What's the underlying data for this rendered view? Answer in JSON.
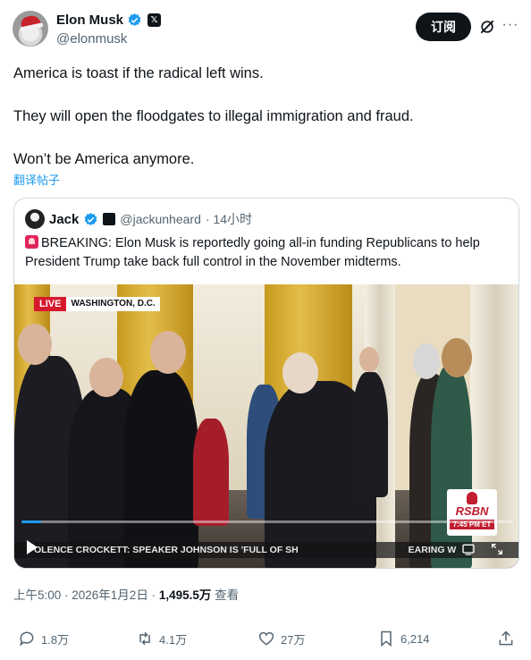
{
  "author": {
    "name": "Elon Musk",
    "handle": "@elonmusk",
    "subscribe_label": "订阅",
    "verified_color": "#1d9bf0"
  },
  "tweet": {
    "lines": [
      "America is toast if the radical left wins.",
      "They will open the floodgates to illegal immigration and fraud.",
      "Won’t be America anymore."
    ],
    "translate_label": "翻译帖子"
  },
  "quote": {
    "name": "Jack",
    "handle": "@jackunheard",
    "time": "· 14小时",
    "text": "BREAKING: Elon Musk is reportedly going all-in funding Republicans to help President Trump take back full control in the November midterms.",
    "video": {
      "live_label": "LIVE",
      "location": "WASHINGTON, D.C.",
      "brand": "RSBN",
      "brand_time": "7:45 PM ET",
      "ticker": "OLENCE    CROCKETT: SPEAKER JOHNSON IS 'FULL OF SH",
      "ticker_tail": "EARING W",
      "progress": 0.04
    }
  },
  "meta": {
    "timestamp": "上午5:00 · 2026年1月2日 · ",
    "views": "1,495.5万",
    "views_label": " 查看"
  },
  "actions": {
    "replies": "1.8万",
    "reposts": "4.1万",
    "likes": "27万",
    "bookmarks": "6,214"
  },
  "icons": [
    "verified-badge-icon",
    "x-logo-icon",
    "grok-icon",
    "more-icon",
    "play-icon",
    "caption-icon",
    "expand-icon",
    "reply-icon",
    "repost-icon",
    "like-icon",
    "bookmark-icon",
    "share-icon"
  ]
}
